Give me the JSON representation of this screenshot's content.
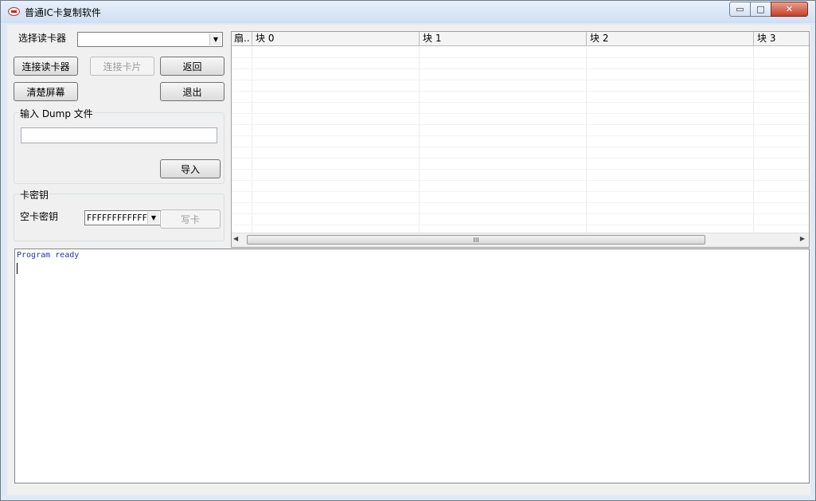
{
  "window": {
    "title": "普通IC卡复制软件",
    "controls": {
      "minimize": "▭",
      "maximize": "□",
      "close": "✕"
    }
  },
  "reader": {
    "label": "选择读卡器",
    "value": ""
  },
  "buttons": {
    "connect_reader": "连接读卡器",
    "connect_card": "连接卡片",
    "back": "返回",
    "clear_screen": "清楚屏幕",
    "exit": "退出",
    "import": "导入",
    "write_card": "写卡"
  },
  "dump_group": {
    "title": "输入 Dump 文件",
    "value": ""
  },
  "key_group": {
    "title": "卡密钥",
    "blank_key_label": "空卡密钥",
    "blank_key_value": "FFFFFFFFFFFF"
  },
  "grid": {
    "columns": [
      "扇..",
      "块 0",
      "块 1",
      "块 2",
      "块 3"
    ],
    "scroll_grip": "III"
  },
  "log": {
    "lines": [
      "Program ready"
    ]
  }
}
